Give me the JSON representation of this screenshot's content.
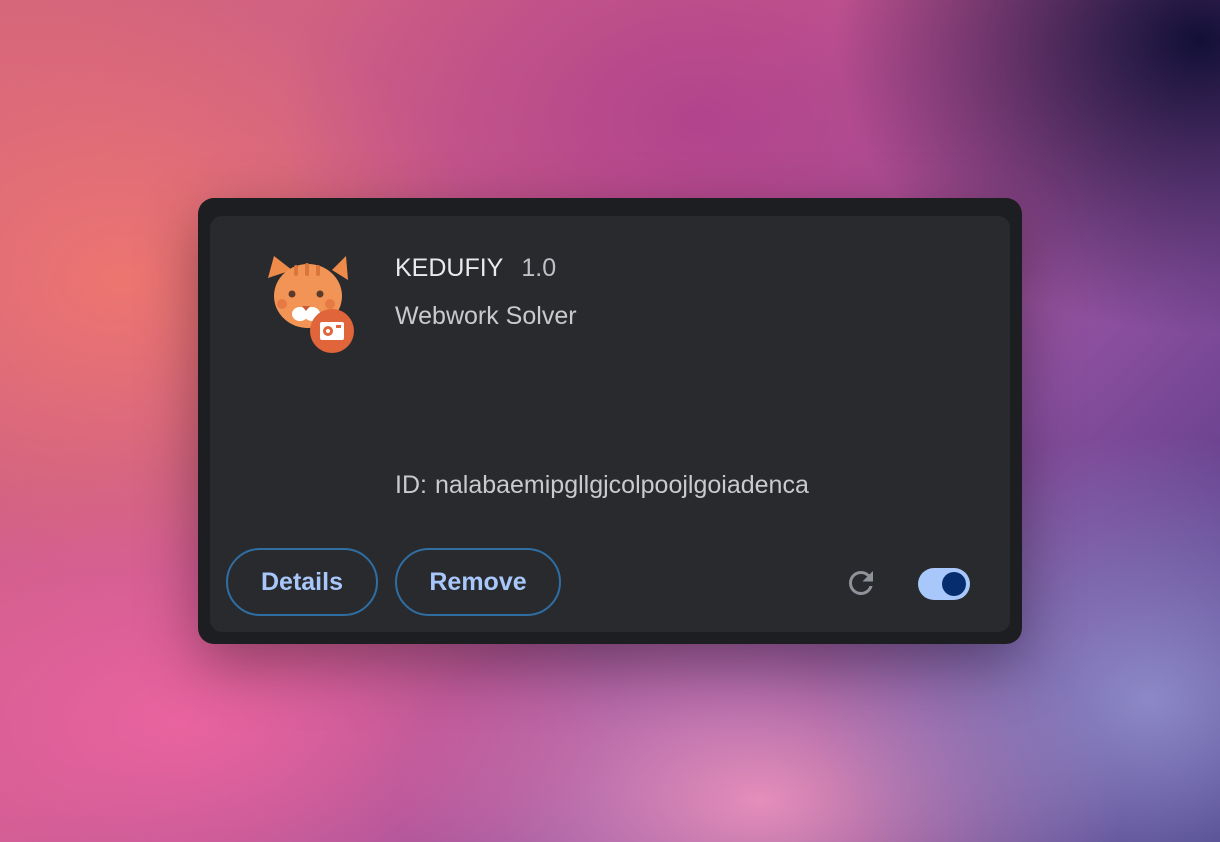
{
  "extension": {
    "name": "KEDUFIY",
    "version": "1.0",
    "description": "Webwork Solver",
    "id_label": "ID:",
    "id_value": "nalabaemipgllgjcolpoojlgoiadenca",
    "icon": "orange-cat-face-with-camera-badge-icon"
  },
  "actions": {
    "details_label": "Details",
    "remove_label": "Remove",
    "reload_icon": "reload-icon",
    "enabled": true
  },
  "colors": {
    "accent": "#a8c7fa",
    "button_border": "#2f6ea3",
    "toggle_knob": "#062e6f",
    "card_bg": "#292a2d",
    "cat_orange": "#ef8b4a",
    "badge_red": "#e0653a"
  }
}
